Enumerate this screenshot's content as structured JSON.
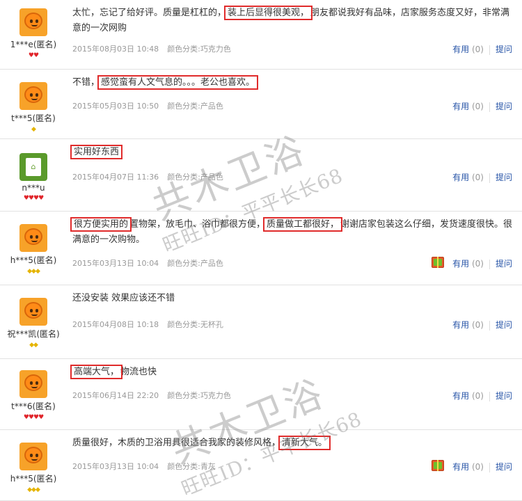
{
  "reviews": [
    {
      "user": "1***e(匿名)",
      "avatar": "taobao-doll-avatar",
      "badge": "heart",
      "badge_count": 2,
      "parts": [
        {
          "t": "太忙，忘记了给好评。质量是杠杠的，",
          "hl": false
        },
        {
          "t": "装上后显得很美观，",
          "hl": true
        },
        {
          "t": "朋友都说我好有品味，店家服务态度又好，非常满意的一次网购",
          "hl": false
        }
      ],
      "date": "2015年08月03日 10:48",
      "spec": "颜色分类:巧克力色",
      "gift": false
    },
    {
      "user": "t***5(匿名)",
      "avatar": "taobao-doll-avatar",
      "badge": "diamond",
      "badge_count": 1,
      "parts": [
        {
          "t": "不错，",
          "hl": false
        },
        {
          "t": "感觉蛮有人文气息的。。。老公也喜欢。",
          "hl": true
        }
      ],
      "date": "2015年05月03日 10:50",
      "spec": "颜色分类:产品色",
      "gift": false
    },
    {
      "user": "n***u",
      "avatar": "green-tile-avatar",
      "badge": "heart",
      "badge_count": 4,
      "parts": [
        {
          "t": "实用好东西",
          "hl": true
        }
      ],
      "date": "2015年04月07日 11:36",
      "spec": "颜色分类:产品色",
      "gift": false
    },
    {
      "user": "h***5(匿名)",
      "avatar": "taobao-doll-avatar",
      "badge": "diamond",
      "badge_count": 3,
      "parts": [
        {
          "t": "很方便实用的",
          "hl": true
        },
        {
          "t": "置物架，放毛巾、浴巾都很方便，",
          "hl": false
        },
        {
          "t": "质量做工都很好，",
          "hl": true
        },
        {
          "t": "谢谢店家包装这么仔细，发货速度很快。很满意的一次购物。",
          "hl": false
        }
      ],
      "date": "2015年03月13日 10:04",
      "spec": "颜色分类:产品色",
      "gift": true
    },
    {
      "user": "祝***凯(匿名)",
      "avatar": "taobao-doll-avatar",
      "badge": "diamond",
      "badge_count": 2,
      "parts": [
        {
          "t": "还没安装 效果应该还不错",
          "hl": false
        }
      ],
      "date": "2015年04月08日 10:18",
      "spec": "颜色分类:无杯孔",
      "gift": false
    },
    {
      "user": "t***6(匿名)",
      "avatar": "taobao-doll-avatar",
      "badge": "heart",
      "badge_count": 4,
      "parts": [
        {
          "t": "高端大气，",
          "hl": true
        },
        {
          "t": "物流也快",
          "hl": false
        }
      ],
      "date": "2015年06月14日 22:20",
      "spec": "颜色分类:巧克力色",
      "gift": false
    },
    {
      "user": "h***5(匿名)",
      "avatar": "taobao-doll-avatar",
      "badge": "diamond",
      "badge_count": 3,
      "parts": [
        {
          "t": "质量很好，木质的卫浴用具很适合我家的装修风格，",
          "hl": false
        },
        {
          "t": "清新大气。",
          "hl": true
        }
      ],
      "date": "2015年03月13日 10:04",
      "spec": "颜色分类:青灰",
      "gift": true
    }
  ],
  "actions": {
    "useful_label": "有用",
    "useful_count": "(0)",
    "ask_label": "提问"
  },
  "watermarks": [
    {
      "main": "共木卫浴",
      "sub": "旺旺ID：平平长长68"
    },
    {
      "main": "共木卫浴",
      "sub": "旺旺ID：平平长长68"
    }
  ]
}
